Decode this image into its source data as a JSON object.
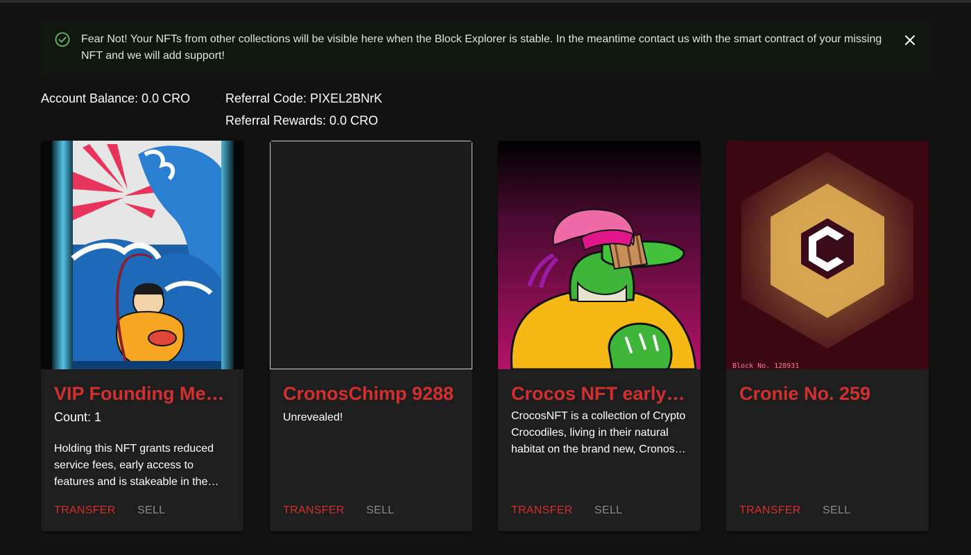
{
  "alert": {
    "icon": "check-circle-icon",
    "message": "Fear Not! Your NFTs from other collections will be visible here when the Block Explorer is stable. In the meantime contact us with the smart contract of your missing NFT and we will add support!",
    "close_icon": "close-icon"
  },
  "account": {
    "balance": "Account Balance: 0.0 CRO",
    "referral_code": "Referral Code: PIXEL2BNrK",
    "referral_rewards": "Referral Rewards: 0.0 CRO"
  },
  "cards": [
    {
      "title": "VIP Founding Member",
      "count": "Count: 1",
      "description": "Holding this NFT grants reduced service fees, early access to features and is stakeable in the upcoming staking pool.",
      "transfer_label": "TRANSFER",
      "sell_label": "SELL"
    },
    {
      "title": "CronosChimp 9288",
      "description": "Unrevealed!",
      "transfer_label": "TRANSFER",
      "sell_label": "SELL"
    },
    {
      "title": "Crocos NFT early founder",
      "description": "CrocosNFT is a collection of Crypto Crocodiles, living in their natural habitat on the brand new, Cronos chain.",
      "transfer_label": "TRANSFER",
      "sell_label": "SELL"
    },
    {
      "title": "Cronie No. 259",
      "image_caption": "Block No. 128931",
      "transfer_label": "TRANSFER",
      "sell_label": "SELL"
    }
  ],
  "colors": {
    "background": "#121212",
    "card": "#1e1e1e",
    "accent_red": "#d32f2f",
    "alert_bg": "#0f170f",
    "success_green": "#66bb6a",
    "muted": "#8a8a8a"
  }
}
